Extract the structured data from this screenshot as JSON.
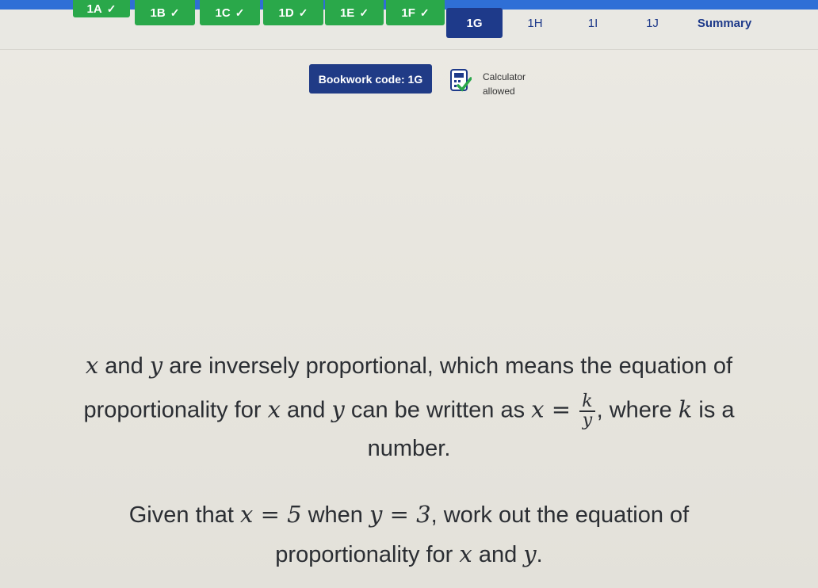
{
  "tabs": [
    {
      "label": "1A",
      "status": "done"
    },
    {
      "label": "1B",
      "status": "done"
    },
    {
      "label": "1C",
      "status": "done"
    },
    {
      "label": "1D",
      "status": "done"
    },
    {
      "label": "1E",
      "status": "done"
    },
    {
      "label": "1F",
      "status": "done"
    },
    {
      "label": "1G",
      "status": "active"
    },
    {
      "label": "1H",
      "status": "todo"
    },
    {
      "label": "1I",
      "status": "todo"
    },
    {
      "label": "1J",
      "status": "todo"
    },
    {
      "label": "Summary",
      "status": "todo"
    }
  ],
  "check_glyph": "✓",
  "bookwork": {
    "label": "Bookwork code: 1G"
  },
  "calculator": {
    "line1": "Calculator",
    "line2": "allowed",
    "icon": "calculator-check-icon"
  },
  "question": {
    "p1": {
      "x": "x",
      "t1": " and ",
      "y": "y",
      "t2": " are inversely proportional, which means the equation of",
      "t3": "proportionality for ",
      "x2": "x",
      "t4": " and ",
      "y2": "y",
      "t5": " can be written as ",
      "x3": "x",
      "eq": " = ",
      "frac_num": "k",
      "frac_den": "y",
      "t6": ", where ",
      "k": "k",
      "t7": " is a",
      "t8": "number."
    },
    "p2": {
      "t1": "Given that ",
      "x": "x",
      "eq1": " = 5",
      "t2": " when ",
      "y": "y",
      "eq2": " = 3",
      "t3": ", work out the equation of",
      "t4": "proportionality for ",
      "x2": "x",
      "t5": " and ",
      "y2": "y",
      "t6": "."
    }
  },
  "colors": {
    "done": "#2aa84a",
    "active": "#1e3a8a",
    "topbar": "#2f6fd6",
    "text": "#2b2e33"
  }
}
